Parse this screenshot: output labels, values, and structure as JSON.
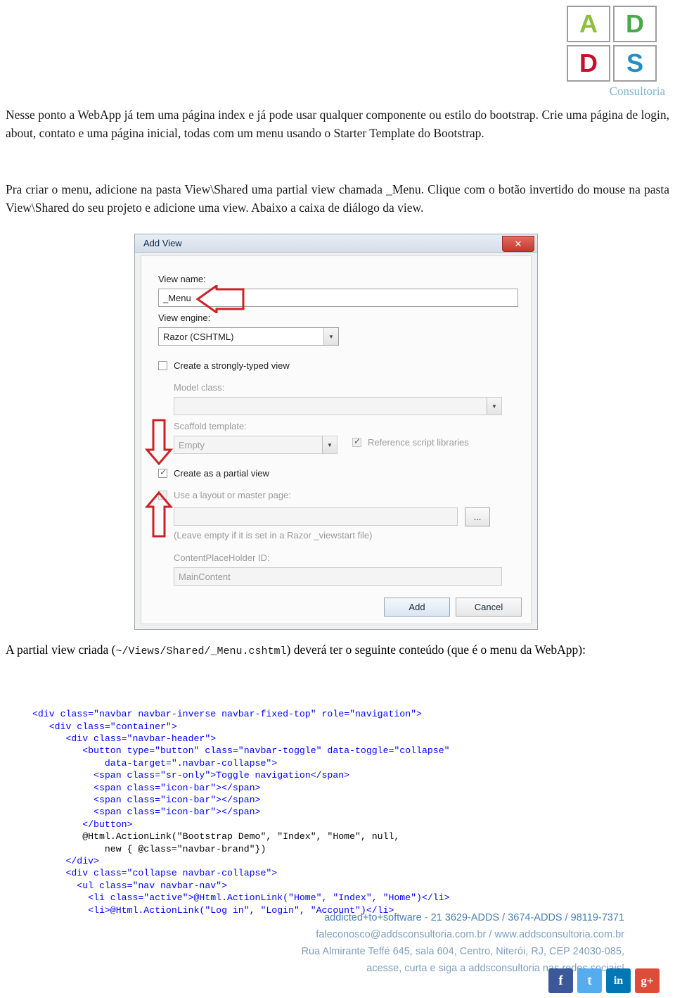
{
  "logo": {
    "cells": [
      "A",
      "D",
      "D",
      "S"
    ],
    "caption": "Consultoria",
    "colors": {
      "a": "#8bbf3c",
      "d1": "#4aa84a",
      "d2": "#c8102e",
      "s": "#1f8fc4"
    }
  },
  "paragraphs": {
    "p1": "Nesse ponto a WebApp já tem uma página index e já pode usar qualquer componente ou estilo do bootstrap. Crie uma página de login, about, contato e uma página inicial, todas com um menu usando o Starter Template do Bootstrap.",
    "p2": "Pra criar o menu, adicione na pasta View\\Shared uma partial view chamada _Menu. Clique com o botão invertido do mouse na pasta View\\Shared do seu projeto e adicione uma view. Abaixo a caixa de diálogo da view.",
    "p3_before": "A partial view criada (",
    "p3_path": "~/Views/Shared/_Menu.cshtml",
    "p3_after": ") deverá ter o seguinte conteúdo (que é o menu da WebApp):"
  },
  "dialog": {
    "title": "Add View",
    "close_label": "✕",
    "view_name_label": "View name:",
    "view_name_value": "_Menu",
    "view_engine_label": "View engine:",
    "view_engine_value": "Razor (CSHTML)",
    "strongly_typed_label": "Create a strongly-typed view",
    "model_class_label": "Model class:",
    "model_class_value": "",
    "scaffold_label": "Scaffold template:",
    "scaffold_value": "Empty",
    "reference_scripts_label": "Reference script libraries",
    "partial_view_label": "Create as a partial view",
    "layout_label": "Use a layout or master page:",
    "layout_value": "",
    "browse_label": "...",
    "hint_label": "(Leave empty if it is set in a Razor _viewstart file)",
    "placeholder_id_label": "ContentPlaceHolder ID:",
    "placeholder_id_value": "MainContent",
    "add_label": "Add",
    "cancel_label": "Cancel"
  },
  "code": {
    "lines": [
      "<div class=\"navbar navbar-inverse navbar-fixed-top\" role=\"navigation\">",
      "   <div class=\"container\">",
      "      <div class=\"navbar-header\">",
      "         <button type=\"button\" class=\"navbar-toggle\" data-toggle=\"collapse\"",
      "             data-target=\".navbar-collapse\">",
      "           <span class=\"sr-only\">Toggle navigation</span>",
      "           <span class=\"icon-bar\"></span>",
      "           <span class=\"icon-bar\"></span>",
      "           <span class=\"icon-bar\"></span>",
      "         </button>",
      "         @Html.ActionLink(\"Bootstrap Demo\", \"Index\", \"Home\", null,",
      "             new { @class=\"navbar-brand\"})",
      "      </div>",
      "      <div class=\"collapse navbar-collapse\">",
      "        <ul class=\"nav navbar-nav\">",
      "          <li class=\"active\">@Html.ActionLink(\"Home\", \"Index\", \"Home\")</li>",
      "          <li>@Html.ActionLink(\"Log in\", \"Login\", \"Account\")</li>"
    ]
  },
  "footer": {
    "line1": "addicted+to+software - 21 3629-ADDS / 3674-ADDS / 98119-7371",
    "line2": "faleconosco@addsconsultoria.com.br / www.addsconsultoria.com.br",
    "line3": "Rua Almirante Teffé 645, sala 604, Centro, Niterói, RJ, CEP 24030-085,",
    "line4": "acesse, curta e siga  a addsconsultoria nas redes sociais!",
    "social": [
      {
        "name": "facebook",
        "glyph": "f"
      },
      {
        "name": "twitter",
        "glyph": "t"
      },
      {
        "name": "linkedin",
        "glyph": "in"
      },
      {
        "name": "googleplus",
        "glyph": "g+"
      }
    ]
  }
}
